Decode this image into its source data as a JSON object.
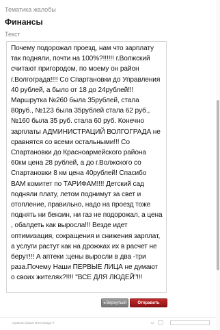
{
  "form": {
    "topic_label": "Тематика жалобы",
    "topic_value": "Финансы",
    "text_label": "Текст",
    "text_value": "Почему подорожал проезд, нам что зарплату так подняли, почти на 100%?!!!!!! г.Волжский считают пригородом, по моему он район г.Волгограда!!!! Со Спартановки до Управления 40 рублей, а было от 18 до 24рублей!!! Маршрутка №260 была 35рублей, стала 80руб., №123 была 35рублей стала 62 руб., №160 была 35 руб. стала 60 руб. Конечно зарплаты АДМИНИСТРАЦИЙ ВОЛГОГРАДА не сравнятся со всеми остальными!!! Со Спартановки до Красноармейского района 60км цена 28 рублей, а до г.Волжского со Спартановки 8 км цена 40рублей! Спасибо ВАМ комитет по ТАРИФАМ!!!! Детский сад подняли плату, летом поднимут за свет и отопление, правильно, надо на проезд тоже поднять ни бензин, ни газ не подорожал, а цена , обалдеть как выросла!!! Везде идет оптимизация, сокращения и снижения зарплат, а услуги растут как на дрожжах их в расчет не берут!!! А аптеки :цены выросли в два -три раза.Почему Наши ПЕРВЫЕ ЛИЦА не думают о своих жителях?!!!! \"ВСЕ ДЛЯ ЛЮДЕЙ\"!!!"
  },
  "buttons": {
    "back_label": "◂ Вернуться",
    "send_label": "Отправить жалобу"
  },
  "footer": {
    "copyright": "Администрация Волгограда ©",
    "lang": "ru"
  }
}
